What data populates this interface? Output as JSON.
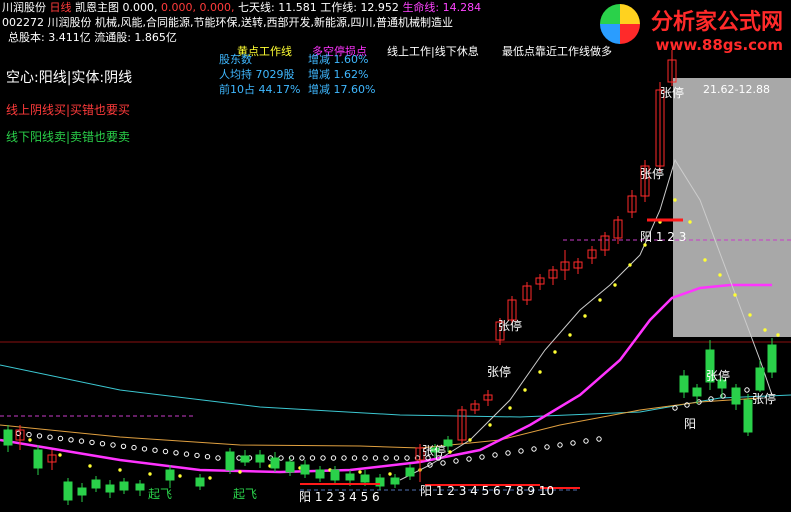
{
  "header": {
    "line1": [
      {
        "text": "川润股份",
        "color": "#ffffff"
      },
      {
        "text": "日线",
        "color": "#ff3b3b"
      },
      {
        "text": "凯恩主图",
        "color": "#ffffff"
      },
      {
        "text": "0.000,",
        "color": "#ffffff"
      },
      {
        "text": "0.000,",
        "color": "#ff3b3b"
      },
      {
        "text": "0.000,",
        "color": "#ff3b3b"
      },
      {
        "text": "七天线:",
        "color": "#ffffff"
      },
      {
        "text": "11.581",
        "color": "#ffffff"
      },
      {
        "text": "工作线:",
        "color": "#ffffff"
      },
      {
        "text": "12.952",
        "color": "#ffffff"
      },
      {
        "text": "生命线:",
        "color": "#ff44ff"
      },
      {
        "text": "14.284",
        "color": "#ff44ff"
      }
    ],
    "line2": "002272 川润股份 机械,风能,合同能源,节能环保,送转,西部开发,新能源,四川,普通机械制造业",
    "line3": "总股本: 3.411亿 流通股: 1.865亿"
  },
  "legend": {
    "mode": "空心:阳线|实体:阴线",
    "rule_up": "线上阴线买|买错也要买",
    "rule_down": "线下阳线卖|卖错也要卖",
    "tabs": [
      "黄点工作线",
      "多空停损点",
      "线上工作|线下休息",
      "最低点靠近工作线做多"
    ]
  },
  "stats": {
    "rows": [
      {
        "label": "股东数",
        "value": "",
        "chg_label": "增减",
        "chg": "1.60%"
      },
      {
        "label": "人均持",
        "value": "7029股",
        "chg_label": "增减",
        "chg": "1.62%"
      },
      {
        "label": "前10占",
        "value": "44.17%",
        "chg_label": "增减",
        "chg": "17.60%"
      }
    ]
  },
  "range_label": "21.62-12.88",
  "watermark": {
    "title": "分析家公式网",
    "url": "www.88gs.com"
  },
  "colors": {
    "up": "#ff2a2a",
    "down": "#2ad14a",
    "work_line": "#ffff33",
    "life_line": "#ff33ff",
    "seven_line": "#cccccc",
    "bg": "#000000"
  },
  "chart_data": {
    "type": "candlestick",
    "title": "川润股份 日线",
    "indicators": {
      "seven_day_line": 11.581,
      "work_line": 12.952,
      "life_line": 14.284
    },
    "annotations": [
      {
        "text": "张停",
        "kind": "limit_up"
      },
      {
        "text": "张停",
        "kind": "limit_up"
      },
      {
        "text": "张停",
        "kind": "limit_up"
      },
      {
        "text": "张停",
        "kind": "limit_up"
      },
      {
        "text": "张停",
        "kind": "limit_up"
      },
      {
        "text": "张停",
        "kind": "limit_up"
      },
      {
        "text": "张停",
        "kind": "limit_up"
      },
      {
        "text": "阳 1 2 3",
        "kind": "count"
      },
      {
        "text": "阳",
        "kind": "count"
      },
      {
        "text": "阳 1 2 3 4 5 6",
        "kind": "count"
      },
      {
        "text": "阳 1 2 3 4 5 6 7 8 9 10",
        "kind": "count"
      },
      {
        "text": "起飞",
        "kind": "signal"
      },
      {
        "text": "起飞",
        "kind": "signal"
      }
    ]
  }
}
